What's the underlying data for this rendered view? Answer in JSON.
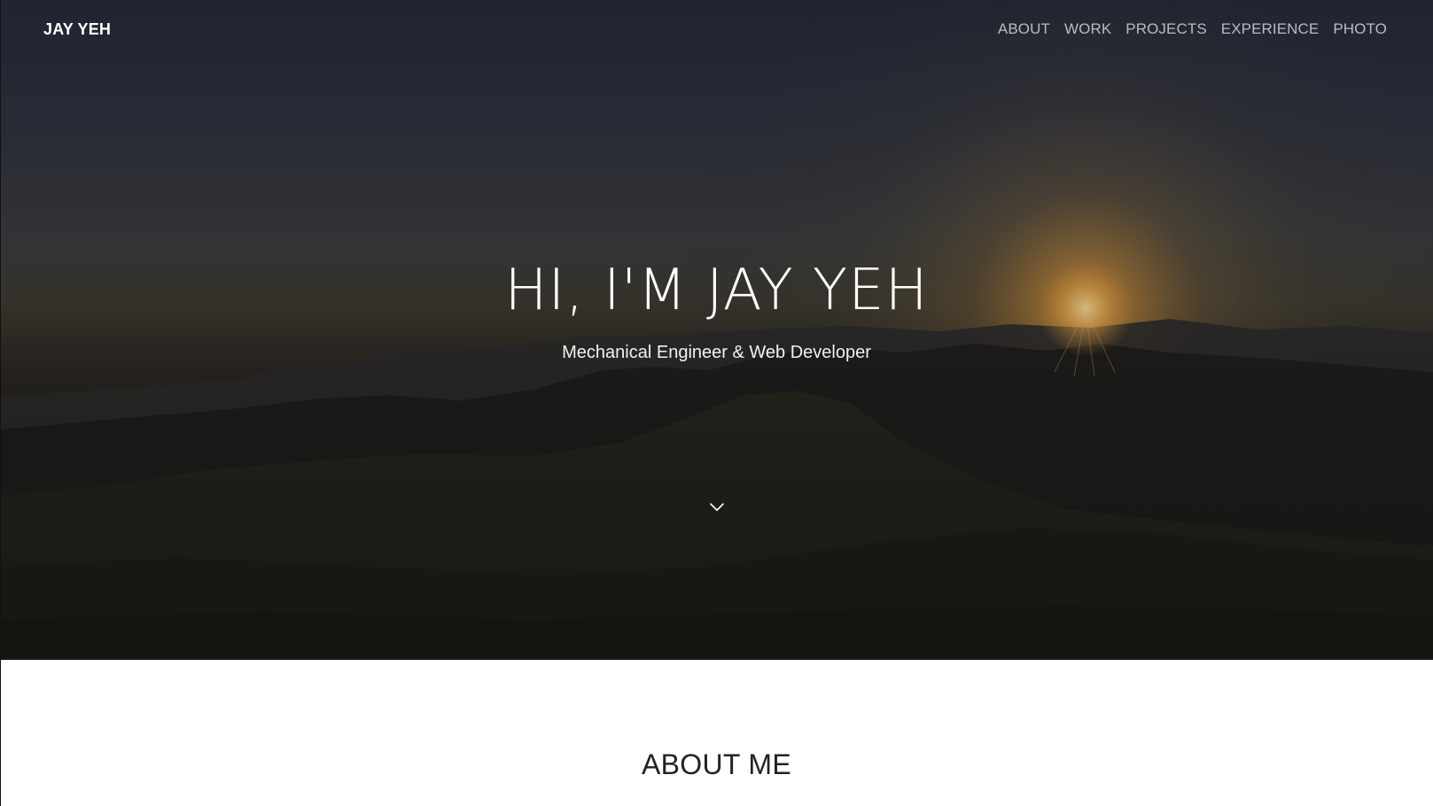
{
  "header": {
    "brand": "JAY YEH",
    "nav": [
      {
        "label": "ABOUT"
      },
      {
        "label": "WORK"
      },
      {
        "label": "PROJECTS"
      },
      {
        "label": "EXPERIENCE"
      },
      {
        "label": "PHOTO"
      }
    ]
  },
  "hero": {
    "title": "HI, I'M JAY YEH",
    "subtitle": "Mechanical Engineer & Web Developer",
    "scroll_icon": "chevron-down-icon",
    "background": "mountain-sunset-photo"
  },
  "about": {
    "title": "ABOUT ME"
  },
  "colors": {
    "hero_text": "#ffffff",
    "nav_text": "#b9bcc2",
    "about_title": "#1f2227",
    "page_background": "#ffffff"
  }
}
